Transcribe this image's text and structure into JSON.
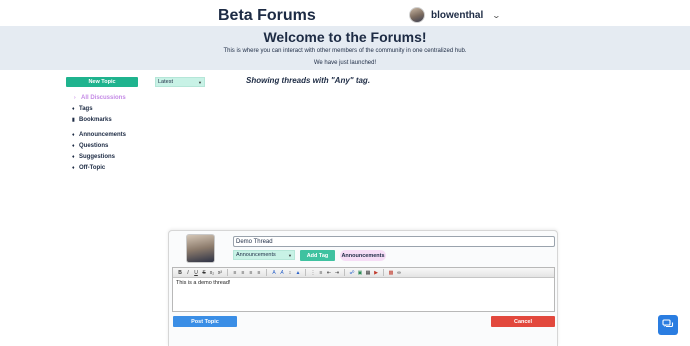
{
  "header": {
    "site_title": "Beta Forums",
    "username": "blowenthal",
    "dropdown_icon": "chevron-down-icon"
  },
  "banner": {
    "title": "Welcome to the Forums!",
    "subtitle": "This is where you can interact with other members of the community in one centralized hub.",
    "announcement": "We have just launched!"
  },
  "sidebar": {
    "new_topic_label": "New Topic",
    "items": [
      {
        "label": "All Discussions",
        "icon": "chevron-right-icon",
        "active": true
      },
      {
        "label": "Tags",
        "icon": "tags-icon"
      },
      {
        "label": "Bookmarks",
        "icon": "bookmark-icon"
      },
      {
        "label": "Announcements",
        "icon": "tag-icon"
      },
      {
        "label": "Questions",
        "icon": "tag-icon"
      },
      {
        "label": "Suggestions",
        "icon": "tag-icon"
      },
      {
        "label": "Off-Topic",
        "icon": "tag-icon"
      }
    ]
  },
  "filter": {
    "selected": "Latest"
  },
  "main": {
    "showing_text": "Showing threads with \"Any\" tag."
  },
  "composer": {
    "title_value": "Demo Thread",
    "category_selected": "Announcements",
    "add_tag_label": "Add Tag",
    "tags": [
      "Announcements"
    ],
    "body_text": "This is a demo thread!",
    "toolbar_glyphs": {
      "bold": "B",
      "italic": "I",
      "underline": "U",
      "strike": "S",
      "subscript": "x₂",
      "superscript": "x²"
    },
    "post_label": "Post Topic",
    "cancel_label": "Cancel"
  },
  "colors": {
    "accent_green": "#1fb38e",
    "active_nav": "#c58be6",
    "primary_blue": "#3a8ee6",
    "danger_red": "#e2483d",
    "banner_bg": "#e5ebf2"
  }
}
